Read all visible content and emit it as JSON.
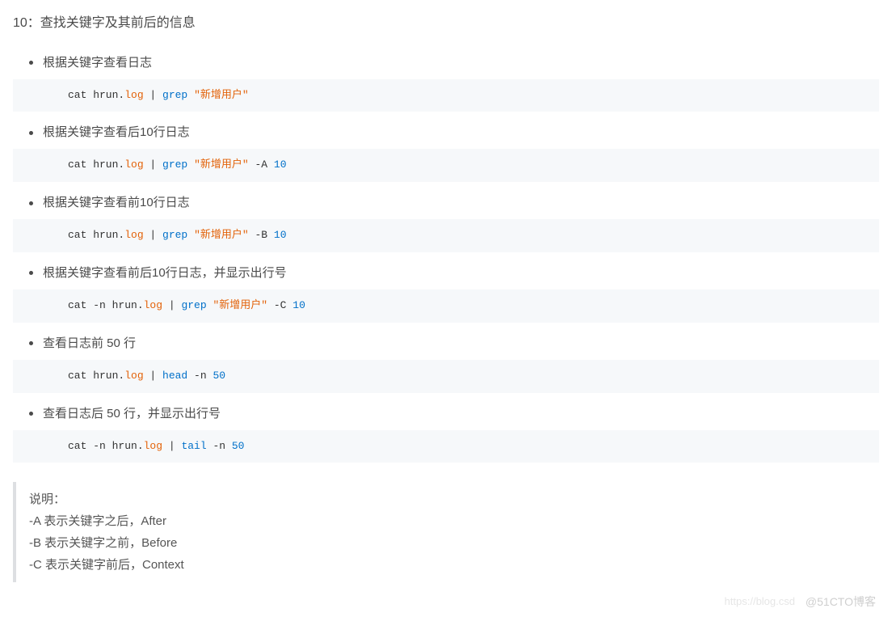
{
  "heading": "10：查找关键字及其前后的信息",
  "sections": [
    {
      "label": "根据关键字查看日志",
      "code": [
        {
          "t": "cat hrun.",
          "c": "plain"
        },
        {
          "t": "log",
          "c": "orange"
        },
        {
          "t": " | ",
          "c": "pipe"
        },
        {
          "t": "grep",
          "c": "blue"
        },
        {
          "t": " ",
          "c": "plain"
        },
        {
          "t": "\"新增用户\"",
          "c": "orange"
        }
      ]
    },
    {
      "label": "根据关键字查看后10行日志",
      "code": [
        {
          "t": "cat hrun.",
          "c": "plain"
        },
        {
          "t": "log",
          "c": "orange"
        },
        {
          "t": " | ",
          "c": "pipe"
        },
        {
          "t": "grep",
          "c": "blue"
        },
        {
          "t": " ",
          "c": "plain"
        },
        {
          "t": "\"新增用户\"",
          "c": "orange"
        },
        {
          "t": " -A ",
          "c": "plain"
        },
        {
          "t": "10",
          "c": "blue"
        }
      ]
    },
    {
      "label": "根据关键字查看前10行日志",
      "code": [
        {
          "t": "cat hrun.",
          "c": "plain"
        },
        {
          "t": "log",
          "c": "orange"
        },
        {
          "t": " | ",
          "c": "pipe"
        },
        {
          "t": "grep",
          "c": "blue"
        },
        {
          "t": " ",
          "c": "plain"
        },
        {
          "t": "\"新增用户\"",
          "c": "orange"
        },
        {
          "t": " -B ",
          "c": "plain"
        },
        {
          "t": "10",
          "c": "blue"
        }
      ]
    },
    {
      "label": "根据关键字查看前后10行日志，并显示出行号",
      "code": [
        {
          "t": "cat -n hrun.",
          "c": "plain"
        },
        {
          "t": "log",
          "c": "orange"
        },
        {
          "t": " | ",
          "c": "pipe"
        },
        {
          "t": "grep",
          "c": "blue"
        },
        {
          "t": " ",
          "c": "plain"
        },
        {
          "t": "\"新增用户\"",
          "c": "orange"
        },
        {
          "t": " -C ",
          "c": "plain"
        },
        {
          "t": "10",
          "c": "blue"
        }
      ]
    },
    {
      "label": "查看日志前 50 行",
      "code": [
        {
          "t": "cat hrun.",
          "c": "plain"
        },
        {
          "t": "log",
          "c": "orange"
        },
        {
          "t": " | ",
          "c": "pipe"
        },
        {
          "t": "head",
          "c": "blue"
        },
        {
          "t": " -n ",
          "c": "plain"
        },
        {
          "t": "50",
          "c": "blue"
        }
      ]
    },
    {
      "label": "查看日志后 50 行，并显示出行号",
      "code": [
        {
          "t": "cat -n hrun.",
          "c": "plain"
        },
        {
          "t": "log",
          "c": "orange"
        },
        {
          "t": " | ",
          "c": "pipe"
        },
        {
          "t": "tail",
          "c": "blue"
        },
        {
          "t": " -n ",
          "c": "plain"
        },
        {
          "t": "50",
          "c": "blue"
        }
      ]
    }
  ],
  "desc": {
    "title": "说明：",
    "lines": [
      "-A 表示关键字之后，After",
      "-B 表示关键字之前，Before",
      "-C 表示关键字前后，Context"
    ]
  },
  "watermark": {
    "left": "https://blog.csd",
    "right": "@51CTO博客"
  }
}
